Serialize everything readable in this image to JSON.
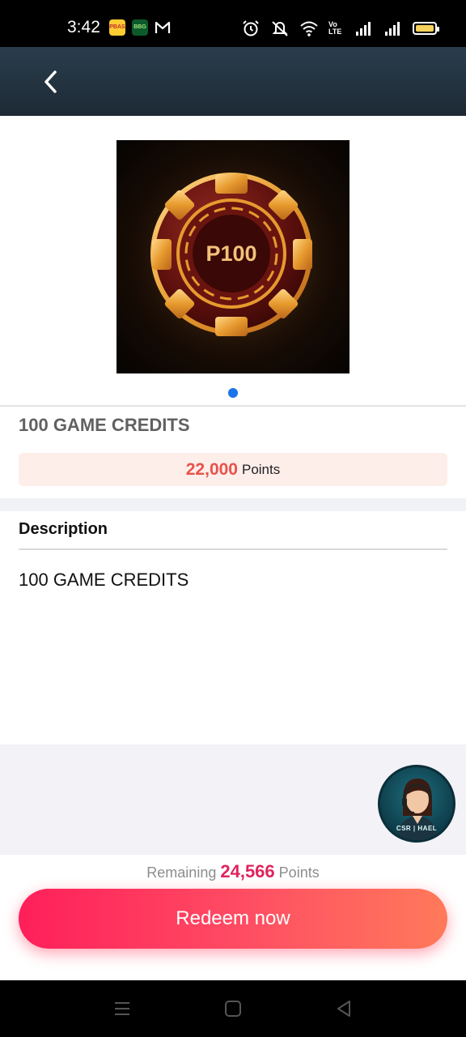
{
  "status_bar": {
    "time": "3:42",
    "app_badges": [
      "PBAS",
      "BBG"
    ],
    "volte_label": "Vo LTE",
    "battery_color": "#f6d15b"
  },
  "header": {
    "back_icon": "chevron-left-icon",
    "background": "#1d2a35"
  },
  "product": {
    "image_text": "P100",
    "title": "100 GAME CREDITS",
    "price_value": "22,000",
    "price_unit": "Points",
    "carousel": {
      "pages": 1,
      "active": 1
    }
  },
  "description": {
    "heading": "Description",
    "body": "100 GAME CREDITS"
  },
  "support": {
    "label": "CSR | HAEL",
    "icon": "customer-support-avatar"
  },
  "footer": {
    "remaining_label": "Remaining",
    "remaining_value": "24,566",
    "remaining_unit": "Points",
    "redeem_label": "Redeem now",
    "accent": "#ff1f5a"
  },
  "nav_bar": {
    "icons": [
      "menu-icon",
      "home-icon",
      "back-icon"
    ]
  }
}
